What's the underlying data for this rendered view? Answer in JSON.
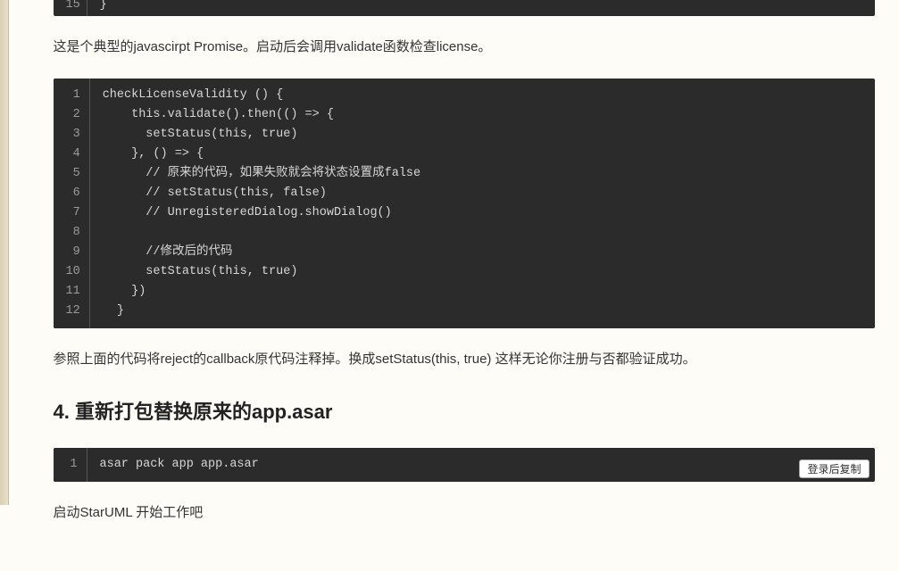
{
  "stub": {
    "lineNumber": "15",
    "content": "}"
  },
  "paragraphs": {
    "p1": "这是个典型的javascirpt Promise。启动后会调用validate函数检查license。",
    "p2": "参照上面的代码将reject的callback原代码注释掉。换成setStatus(this, true) 这样无论你注册与否都验证成功。",
    "p3": "启动StarUML 开始工作吧"
  },
  "heading": "4. 重新打包替换原来的app.asar",
  "codeBlock1": {
    "lineNumbers": [
      "1",
      "2",
      "3",
      "4",
      "5",
      "6",
      "7",
      "8",
      "9",
      "10",
      "11",
      "12"
    ],
    "lines": [
      "checkLicenseValidity () {",
      "    this.validate().then(() => {",
      "      setStatus(this, true)",
      "    }, () => {",
      "      // 原来的代码，如果失败就会将状态设置成false",
      "      // setStatus(this, false)",
      "      // UnregisteredDialog.showDialog()",
      "",
      "      //修改后的代码",
      "      setStatus(this, true)",
      "    })",
      "  }"
    ]
  },
  "codeBlock2": {
    "lineNumbers": [
      "1"
    ],
    "lines": [
      "asar pack app app.asar"
    ],
    "copyLabel": "登录后复制"
  }
}
